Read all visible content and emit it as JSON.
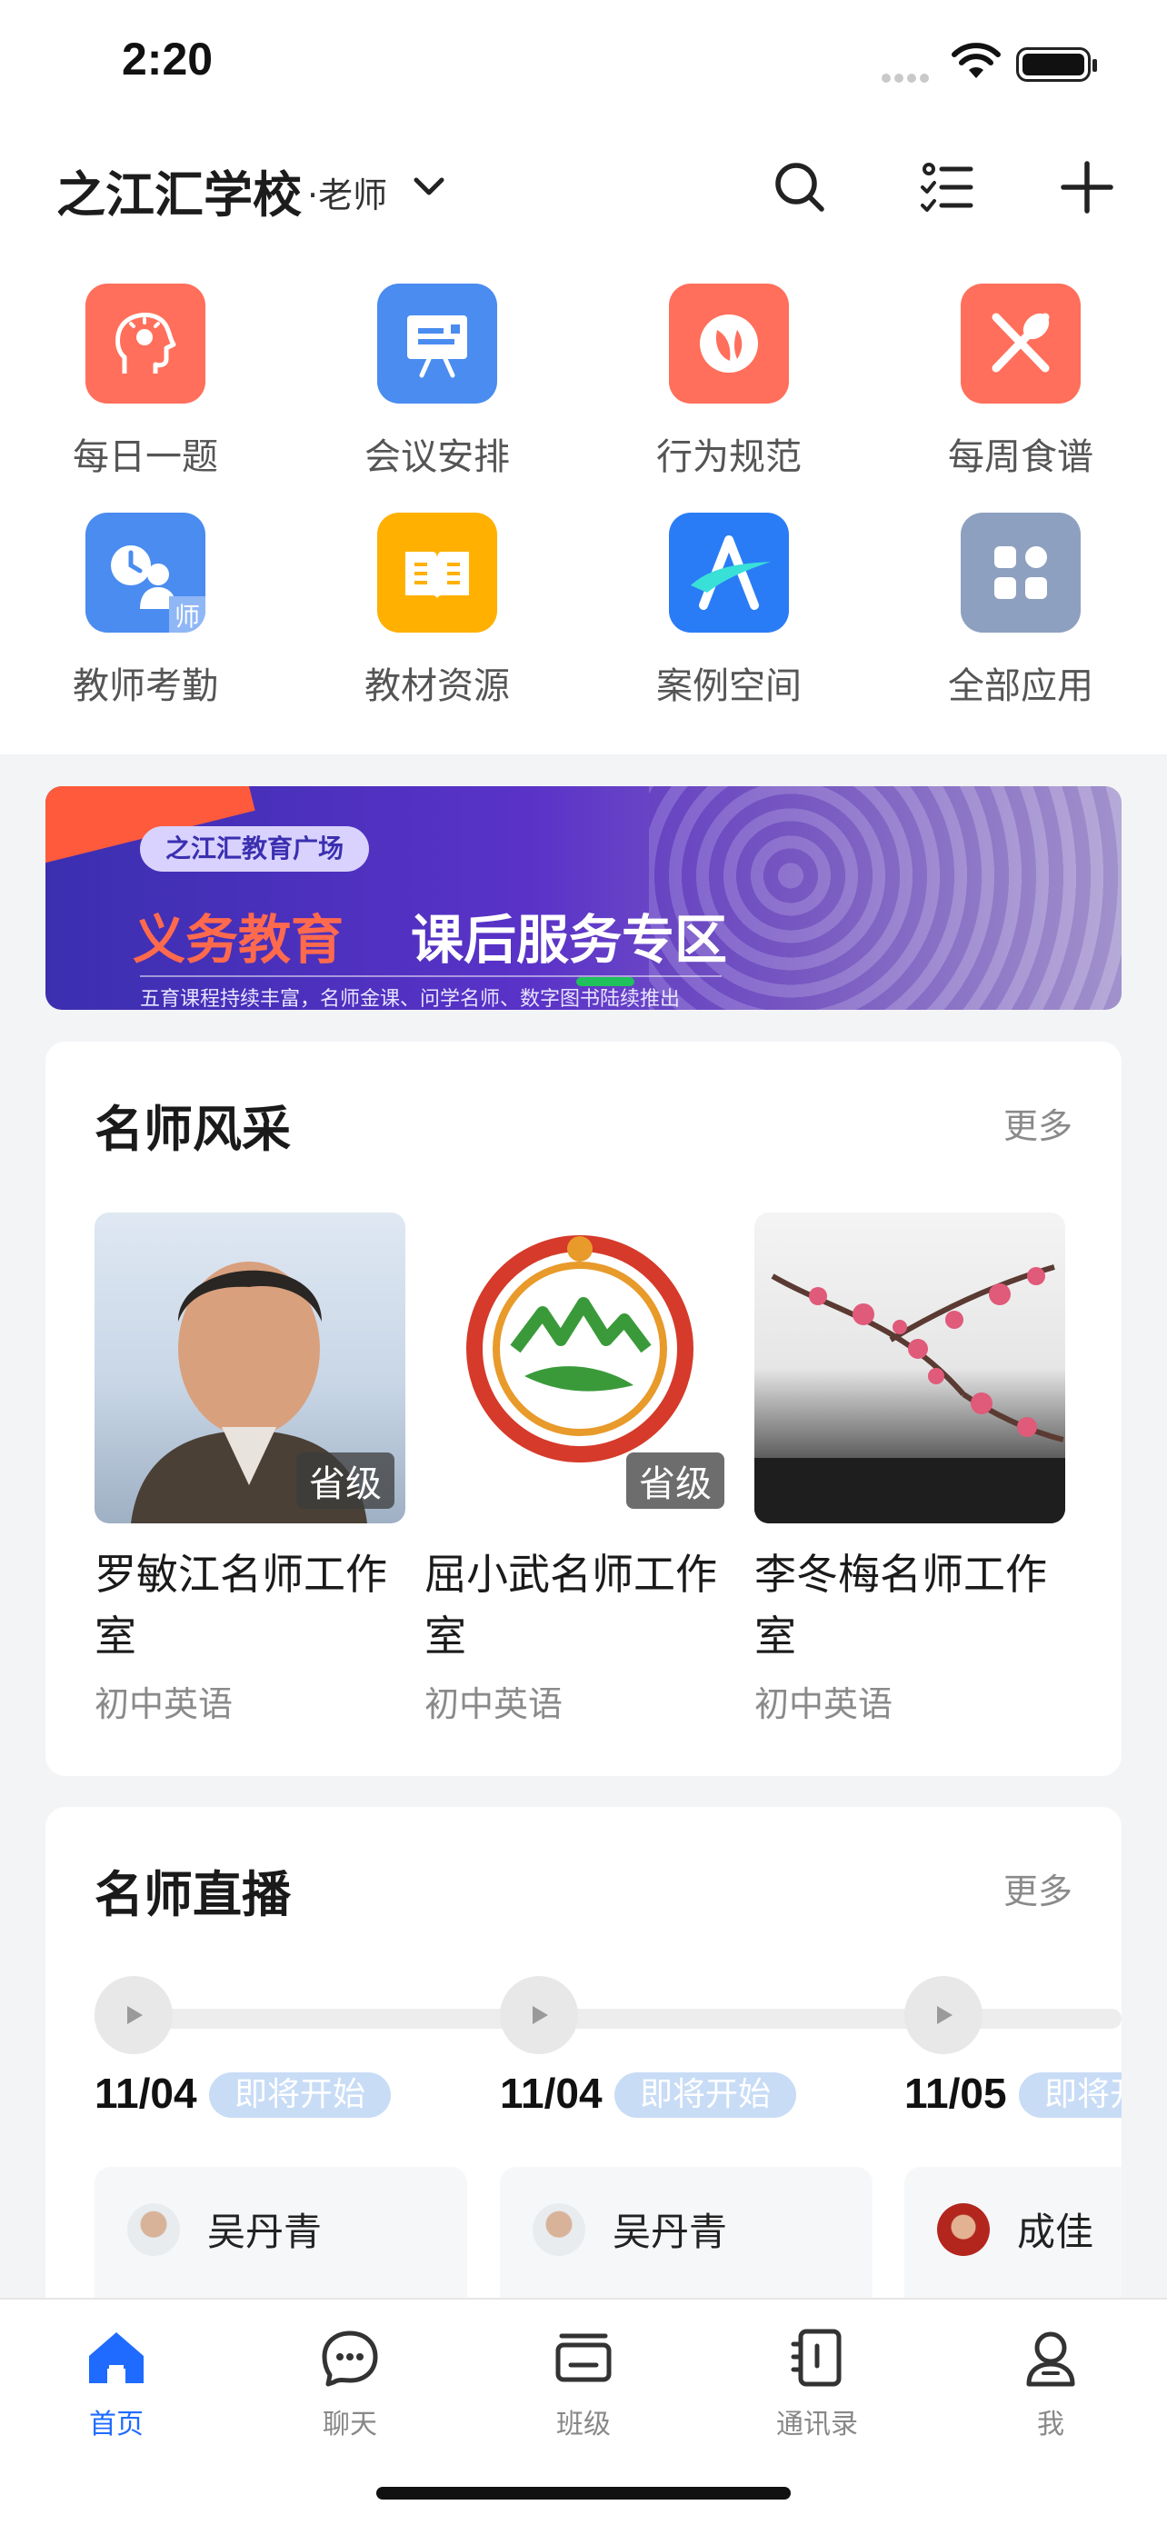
{
  "status": {
    "time": "2:20"
  },
  "header": {
    "school": "之江汇学校",
    "role": "·老师"
  },
  "apps": [
    {
      "label": "每日一题",
      "icon": "head-lightbulb-icon",
      "color": "#ff6f5b"
    },
    {
      "label": "会议安排",
      "icon": "presentation-board-icon",
      "color": "#4a8cf0"
    },
    {
      "label": "行为规范",
      "icon": "shield-leaf-icon",
      "color": "#ff6f5b"
    },
    {
      "label": "每周食谱",
      "icon": "fork-spoon-icon",
      "color": "#ff6f5b"
    },
    {
      "label": "教师考勤",
      "icon": "clock-teacher-icon",
      "color": "#4a8cf0",
      "badge": "师"
    },
    {
      "label": "教材资源",
      "icon": "open-book-icon",
      "color": "#ffb000"
    },
    {
      "label": "案例空间",
      "icon": "letter-a-icon",
      "color": "#2a7cf6"
    },
    {
      "label": "全部应用",
      "icon": "grid-apps-icon",
      "color": "#8ea0bf"
    }
  ],
  "banner": {
    "tag": "之江汇教育广场",
    "title_accent": "义务教育",
    "title_main": "课后服务专区",
    "subtitle": "五育课程持续丰富，名师金课、问学名师、数字图书陆续推出"
  },
  "famous_teachers": {
    "title": "名师风采",
    "more": "更多",
    "items": [
      {
        "name": "罗敏江名师工作室",
        "subject": "初中英语",
        "badge": "省级"
      },
      {
        "name": "屈小武名师工作室",
        "subject": "初中英语",
        "badge": "省级"
      },
      {
        "name": "李冬梅名师工作室",
        "subject": "初中英语",
        "badge": ""
      }
    ]
  },
  "live": {
    "title": "名师直播",
    "more": "更多",
    "items": [
      {
        "date": "11/04",
        "status": "即将开始",
        "teacher": "吴丹青"
      },
      {
        "date": "11/04",
        "status": "即将开始",
        "teacher": "吴丹青"
      },
      {
        "date": "11/05",
        "status": "即将开始",
        "teacher": "成佳"
      }
    ]
  },
  "tabs": [
    {
      "label": "首页",
      "icon": "home-icon",
      "active": true
    },
    {
      "label": "聊天",
      "icon": "chat-bubble-icon",
      "active": false
    },
    {
      "label": "班级",
      "icon": "class-icon",
      "active": false
    },
    {
      "label": "通讯录",
      "icon": "contacts-book-icon",
      "active": false
    },
    {
      "label": "我",
      "icon": "person-icon",
      "active": false
    }
  ],
  "colors": {
    "accent": "#1f6bff",
    "coral": "#ff6f5b",
    "blue": "#4a8cf0"
  }
}
